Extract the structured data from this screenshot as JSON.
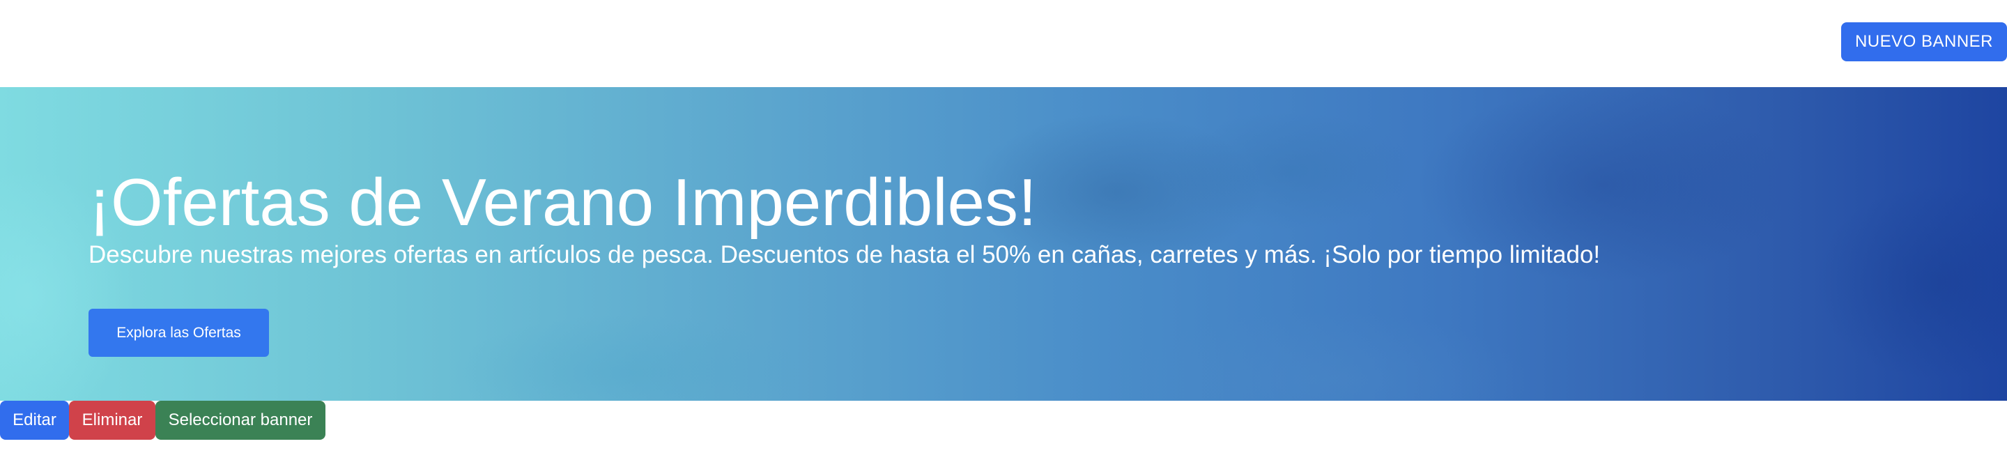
{
  "header": {
    "new_banner_label": "NUEVO BANNER"
  },
  "banner": {
    "title": "¡Ofertas de Verano Imperdibles!",
    "subtitle": "Descubre nuestras mejores ofertas en artículos de pesca. Descuentos de hasta el 50% en cañas, carretes y más. ¡Solo por tiempo limitado!",
    "cta_label": "Explora las Ofertas",
    "gradient_start": "#7fdbe1",
    "gradient_end": "#1e45a1"
  },
  "actions": {
    "edit_label": "Editar",
    "delete_label": "Eliminar",
    "select_label": "Seleccionar banner"
  },
  "colors": {
    "primary": "#316ded",
    "danger": "#d0424a",
    "success": "#3b8255"
  }
}
